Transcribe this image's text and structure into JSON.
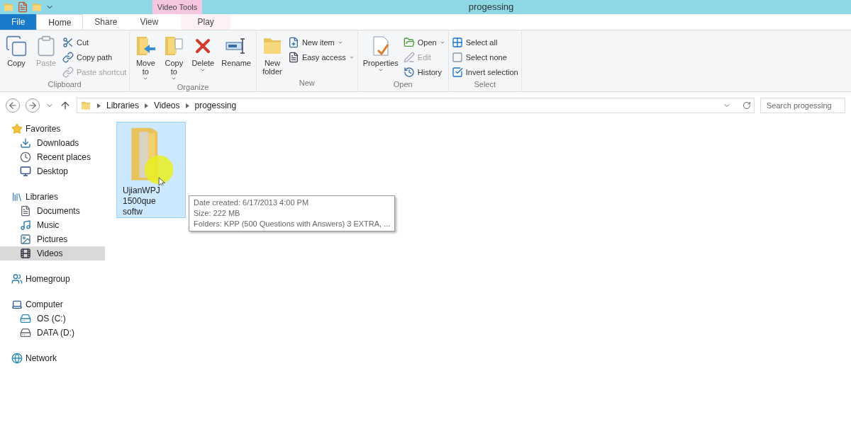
{
  "window": {
    "title": "progessing",
    "context_tab": "Video Tools"
  },
  "tabs": [
    {
      "label": "File",
      "kind": "file",
      "selected": false
    },
    {
      "label": "Home",
      "kind": "tab",
      "selected": true
    },
    {
      "label": "Share",
      "kind": "tab",
      "selected": false
    },
    {
      "label": "View",
      "kind": "tab",
      "selected": false
    },
    {
      "label": "Play",
      "kind": "context",
      "selected": false
    }
  ],
  "ribbon": {
    "groups": [
      {
        "label": "Clipboard",
        "large": [
          {
            "label": "Copy",
            "disabled": false,
            "dropdown": false
          },
          {
            "label": "Paste",
            "disabled": true,
            "dropdown": false
          }
        ],
        "small": [
          {
            "label": "Cut",
            "disabled": false,
            "dropdown": false
          },
          {
            "label": "Copy path",
            "disabled": false,
            "dropdown": false
          },
          {
            "label": "Paste shortcut",
            "disabled": true,
            "dropdown": false
          }
        ]
      },
      {
        "label": "Organize",
        "large": [
          {
            "label": "Move to",
            "disabled": false,
            "dropdown": true
          },
          {
            "label": "Copy to",
            "disabled": false,
            "dropdown": true
          },
          {
            "label": "Delete",
            "disabled": false,
            "dropdown": true
          },
          {
            "label": "Rename",
            "disabled": false,
            "dropdown": false
          }
        ]
      },
      {
        "label": "New",
        "large": [
          {
            "label": "New folder",
            "disabled": false,
            "dropdown": false
          }
        ],
        "small": [
          {
            "label": "New item",
            "disabled": false,
            "dropdown": true
          },
          {
            "label": "Easy access",
            "disabled": false,
            "dropdown": true
          }
        ]
      },
      {
        "label": "Open",
        "large": [
          {
            "label": "Properties",
            "disabled": false,
            "dropdown": true
          }
        ],
        "small": [
          {
            "label": "Open",
            "disabled": false,
            "dropdown": true
          },
          {
            "label": "Edit",
            "disabled": true,
            "dropdown": false
          },
          {
            "label": "History",
            "disabled": false,
            "dropdown": false
          }
        ]
      },
      {
        "label": "Select",
        "small": [
          {
            "label": "Select all",
            "disabled": false,
            "dropdown": false
          },
          {
            "label": "Select none",
            "disabled": false,
            "dropdown": false
          },
          {
            "label": "Invert selection",
            "disabled": false,
            "dropdown": false
          }
        ]
      }
    ]
  },
  "address": {
    "crumbs": [
      "Libraries",
      "Videos",
      "progessing"
    ]
  },
  "search": {
    "placeholder": "Search progessing"
  },
  "sidebar": {
    "sections": [
      {
        "label": "Favorites",
        "selected": false,
        "children": [
          {
            "label": "Downloads",
            "selected": false
          },
          {
            "label": "Recent places",
            "selected": false
          },
          {
            "label": "Desktop",
            "selected": false
          }
        ]
      },
      {
        "label": "Libraries",
        "selected": false,
        "children": [
          {
            "label": "Documents",
            "selected": false
          },
          {
            "label": "Music",
            "selected": false
          },
          {
            "label": "Pictures",
            "selected": false
          },
          {
            "label": "Videos",
            "selected": true
          }
        ]
      },
      {
        "label": "Homegroup",
        "selected": false
      },
      {
        "label": "Computer",
        "selected": false,
        "children": [
          {
            "label": "OS (C:)",
            "selected": false
          },
          {
            "label": "DATA (D:)",
            "selected": false
          }
        ]
      },
      {
        "label": "Network",
        "selected": false
      }
    ]
  },
  "items": [
    {
      "name_lines": [
        "UjianWPJ",
        "1500que",
        "softw"
      ],
      "selected": true
    }
  ],
  "tooltip": {
    "lines": [
      "Date created: 6/17/2013 4:00 PM",
      "Size: 222 MB",
      "Folders: KPP (500 Questions with Answers) 3 EXTRA, ..."
    ]
  }
}
